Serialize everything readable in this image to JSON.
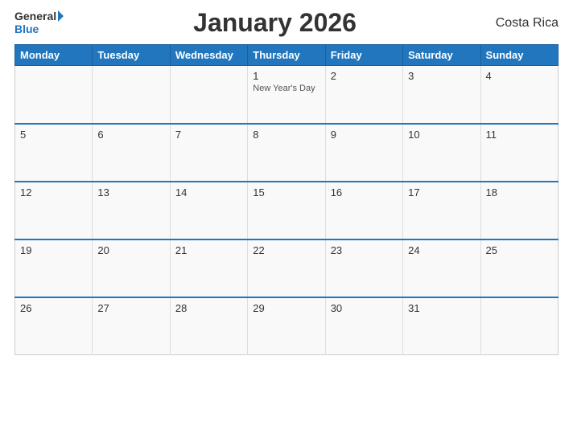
{
  "header": {
    "logo": {
      "general": "General",
      "blue": "Blue"
    },
    "title": "January 2026",
    "country": "Costa Rica"
  },
  "calendar": {
    "days_of_week": [
      "Monday",
      "Tuesday",
      "Wednesday",
      "Thursday",
      "Friday",
      "Saturday",
      "Sunday"
    ],
    "weeks": [
      [
        {
          "day": "",
          "holiday": ""
        },
        {
          "day": "",
          "holiday": ""
        },
        {
          "day": "",
          "holiday": ""
        },
        {
          "day": "1",
          "holiday": "New Year's Day"
        },
        {
          "day": "2",
          "holiday": ""
        },
        {
          "day": "3",
          "holiday": ""
        },
        {
          "day": "4",
          "holiday": ""
        }
      ],
      [
        {
          "day": "5",
          "holiday": ""
        },
        {
          "day": "6",
          "holiday": ""
        },
        {
          "day": "7",
          "holiday": ""
        },
        {
          "day": "8",
          "holiday": ""
        },
        {
          "day": "9",
          "holiday": ""
        },
        {
          "day": "10",
          "holiday": ""
        },
        {
          "day": "11",
          "holiday": ""
        }
      ],
      [
        {
          "day": "12",
          "holiday": ""
        },
        {
          "day": "13",
          "holiday": ""
        },
        {
          "day": "14",
          "holiday": ""
        },
        {
          "day": "15",
          "holiday": ""
        },
        {
          "day": "16",
          "holiday": ""
        },
        {
          "day": "17",
          "holiday": ""
        },
        {
          "day": "18",
          "holiday": ""
        }
      ],
      [
        {
          "day": "19",
          "holiday": ""
        },
        {
          "day": "20",
          "holiday": ""
        },
        {
          "day": "21",
          "holiday": ""
        },
        {
          "day": "22",
          "holiday": ""
        },
        {
          "day": "23",
          "holiday": ""
        },
        {
          "day": "24",
          "holiday": ""
        },
        {
          "day": "25",
          "holiday": ""
        }
      ],
      [
        {
          "day": "26",
          "holiday": ""
        },
        {
          "day": "27",
          "holiday": ""
        },
        {
          "day": "28",
          "holiday": ""
        },
        {
          "day": "29",
          "holiday": ""
        },
        {
          "day": "30",
          "holiday": ""
        },
        {
          "day": "31",
          "holiday": ""
        },
        {
          "day": "",
          "holiday": ""
        }
      ]
    ]
  }
}
